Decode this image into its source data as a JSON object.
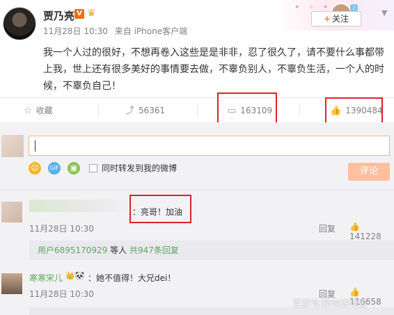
{
  "post": {
    "username": "贾乃亮",
    "time": "11月28日 10:30",
    "source": "来自 iPhone客户端",
    "follow_label": "关注",
    "text": "我一个人过的很好，不想再卷入这些是是非非，忍了很久了，请不要什么事都带上我，世上还有很多美好的事情要去做，不辜负别人，不辜负生活，一个人的时候，不辜负自己！"
  },
  "actions": {
    "favorite": "收藏",
    "repost": "56361",
    "comment": "163109",
    "like": "1390484"
  },
  "compose": {
    "repost_label": "同时转发到我的微博",
    "submit": "评论"
  },
  "comments": [
    {
      "text": "：亮哥！加油",
      "time": "11月28日 10:30",
      "reply": "回复",
      "likes": "141228",
      "subreplies": {
        "user": "用户6895170929",
        "middle": " 等人 ",
        "count": "共947条回复"
      }
    },
    {
      "user": "寒寒宋儿",
      "text": "：她不值得！大兄dei！",
      "time": "11月28日 10:30",
      "reply": "回复",
      "likes": "116658"
    }
  ],
  "watermark": "百家号/新晌说电影",
  "colors": {
    "accent_orange": "#ff8140",
    "highlight_red": "#d9232b",
    "link_green": "#5fa85a"
  }
}
